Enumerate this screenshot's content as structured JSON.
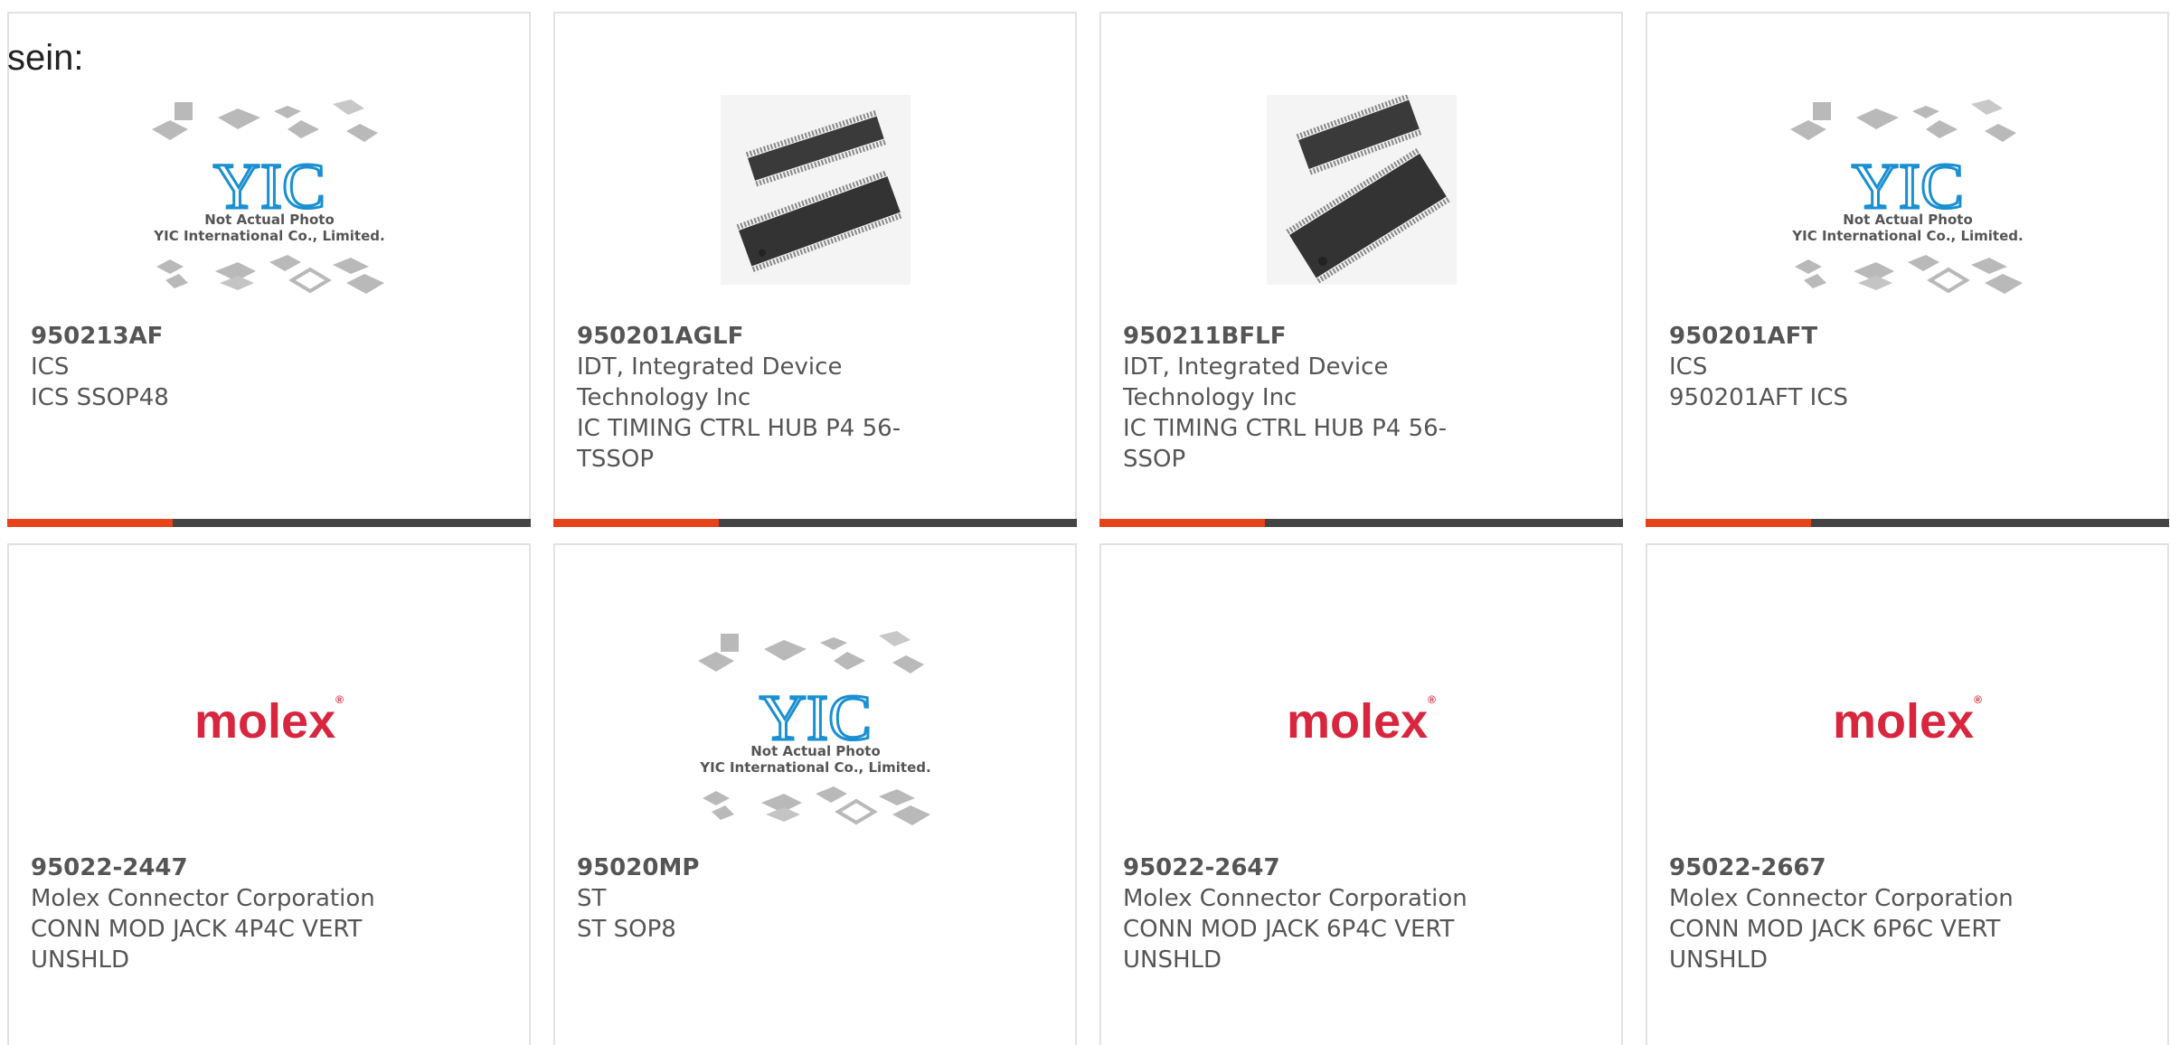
{
  "intro_text": "sein:",
  "colors": {
    "card_border": "#e2e2e2",
    "accent_orange": "#e8421a",
    "accent_dark": "#444444",
    "molex_red": "#d7263d",
    "yic_blue": "#1a8fd1"
  },
  "placeholder": {
    "line1": "Not Actual Photo",
    "line2": "YIC International Co., Limited.",
    "logo_text": "YIC"
  },
  "molex": {
    "logo_text": "molex"
  },
  "products": [
    {
      "part_number": "950213AF",
      "manufacturer": "ICS",
      "desc_lines": [
        "ICS SSOP48"
      ],
      "image": "yic-placeholder",
      "has_accent_bar": true
    },
    {
      "part_number": "950201AGLF",
      "manufacturer_lines": [
        "IDT, Integrated Device",
        "Technology Inc"
      ],
      "desc_lines": [
        "IC TIMING CTRL HUB P4 56-",
        "TSSOP"
      ],
      "image": "tssop-chip-photo",
      "has_accent_bar": true
    },
    {
      "part_number": "950211BFLF",
      "manufacturer_lines": [
        "IDT, Integrated Device",
        "Technology Inc"
      ],
      "desc_lines": [
        "IC TIMING CTRL HUB P4 56-",
        "SSOP"
      ],
      "image": "ssop-chip-photo",
      "has_accent_bar": true
    },
    {
      "part_number": "950201AFT",
      "manufacturer": "ICS",
      "desc_lines": [
        "950201AFT ICS"
      ],
      "image": "yic-placeholder",
      "has_accent_bar": true
    },
    {
      "part_number": "95022-2447",
      "manufacturer": "Molex Connector Corporation",
      "desc_lines": [
        "CONN MOD JACK 4P4C VERT",
        "UNSHLD"
      ],
      "image": "molex-logo"
    },
    {
      "part_number": "95020MP",
      "manufacturer": "ST",
      "desc_lines": [
        "ST SOP8"
      ],
      "image": "yic-placeholder"
    },
    {
      "part_number": "95022-2647",
      "manufacturer": "Molex Connector Corporation",
      "desc_lines": [
        "CONN MOD JACK 6P4C VERT",
        "UNSHLD"
      ],
      "image": "molex-logo"
    },
    {
      "part_number": "95022-2667",
      "manufacturer": "Molex Connector Corporation",
      "desc_lines": [
        "CONN MOD JACK 6P6C VERT",
        "UNSHLD"
      ],
      "image": "molex-logo"
    }
  ]
}
